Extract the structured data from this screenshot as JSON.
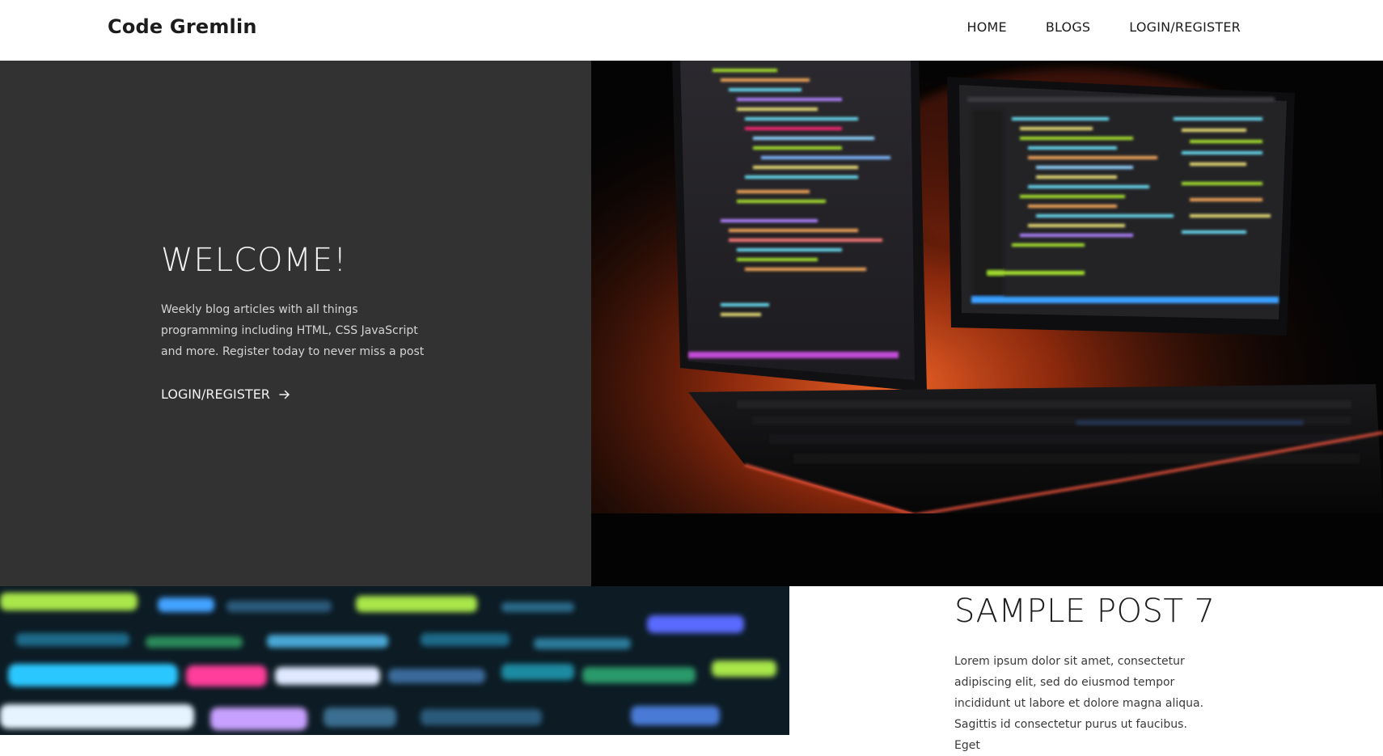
{
  "header": {
    "brand": "Code Gremlin",
    "nav": {
      "home": "HOME",
      "blogs": "BLOGS",
      "login": "LOGIN/REGISTER"
    }
  },
  "hero": {
    "title": "WELCOME!",
    "text": "Weekly blog articles with all things programming including HTML, CSS JavaScript and more. Register today to never miss a post",
    "cta_label": "LOGIN/REGISTER",
    "cta_icon": "arrow-right-icon",
    "image": "photo of two monitors showing code with a backlit keyboard"
  },
  "post": {
    "title": "SAMPLE POST 7",
    "excerpt": "Lorem ipsum dolor sit amet, consectetur adipiscing elit, sed do eiusmod tempor incididunt ut labore et dolore magna aliqua. Sagittis id consectetur purus ut faucibus. Eget",
    "image": "blurred close-up of colorful code on a screen"
  },
  "colors": {
    "hero_bg": "#323233",
    "text_dark": "#1c1c1c",
    "text_light": "#f2f2f2",
    "glow": "#e0501d"
  }
}
